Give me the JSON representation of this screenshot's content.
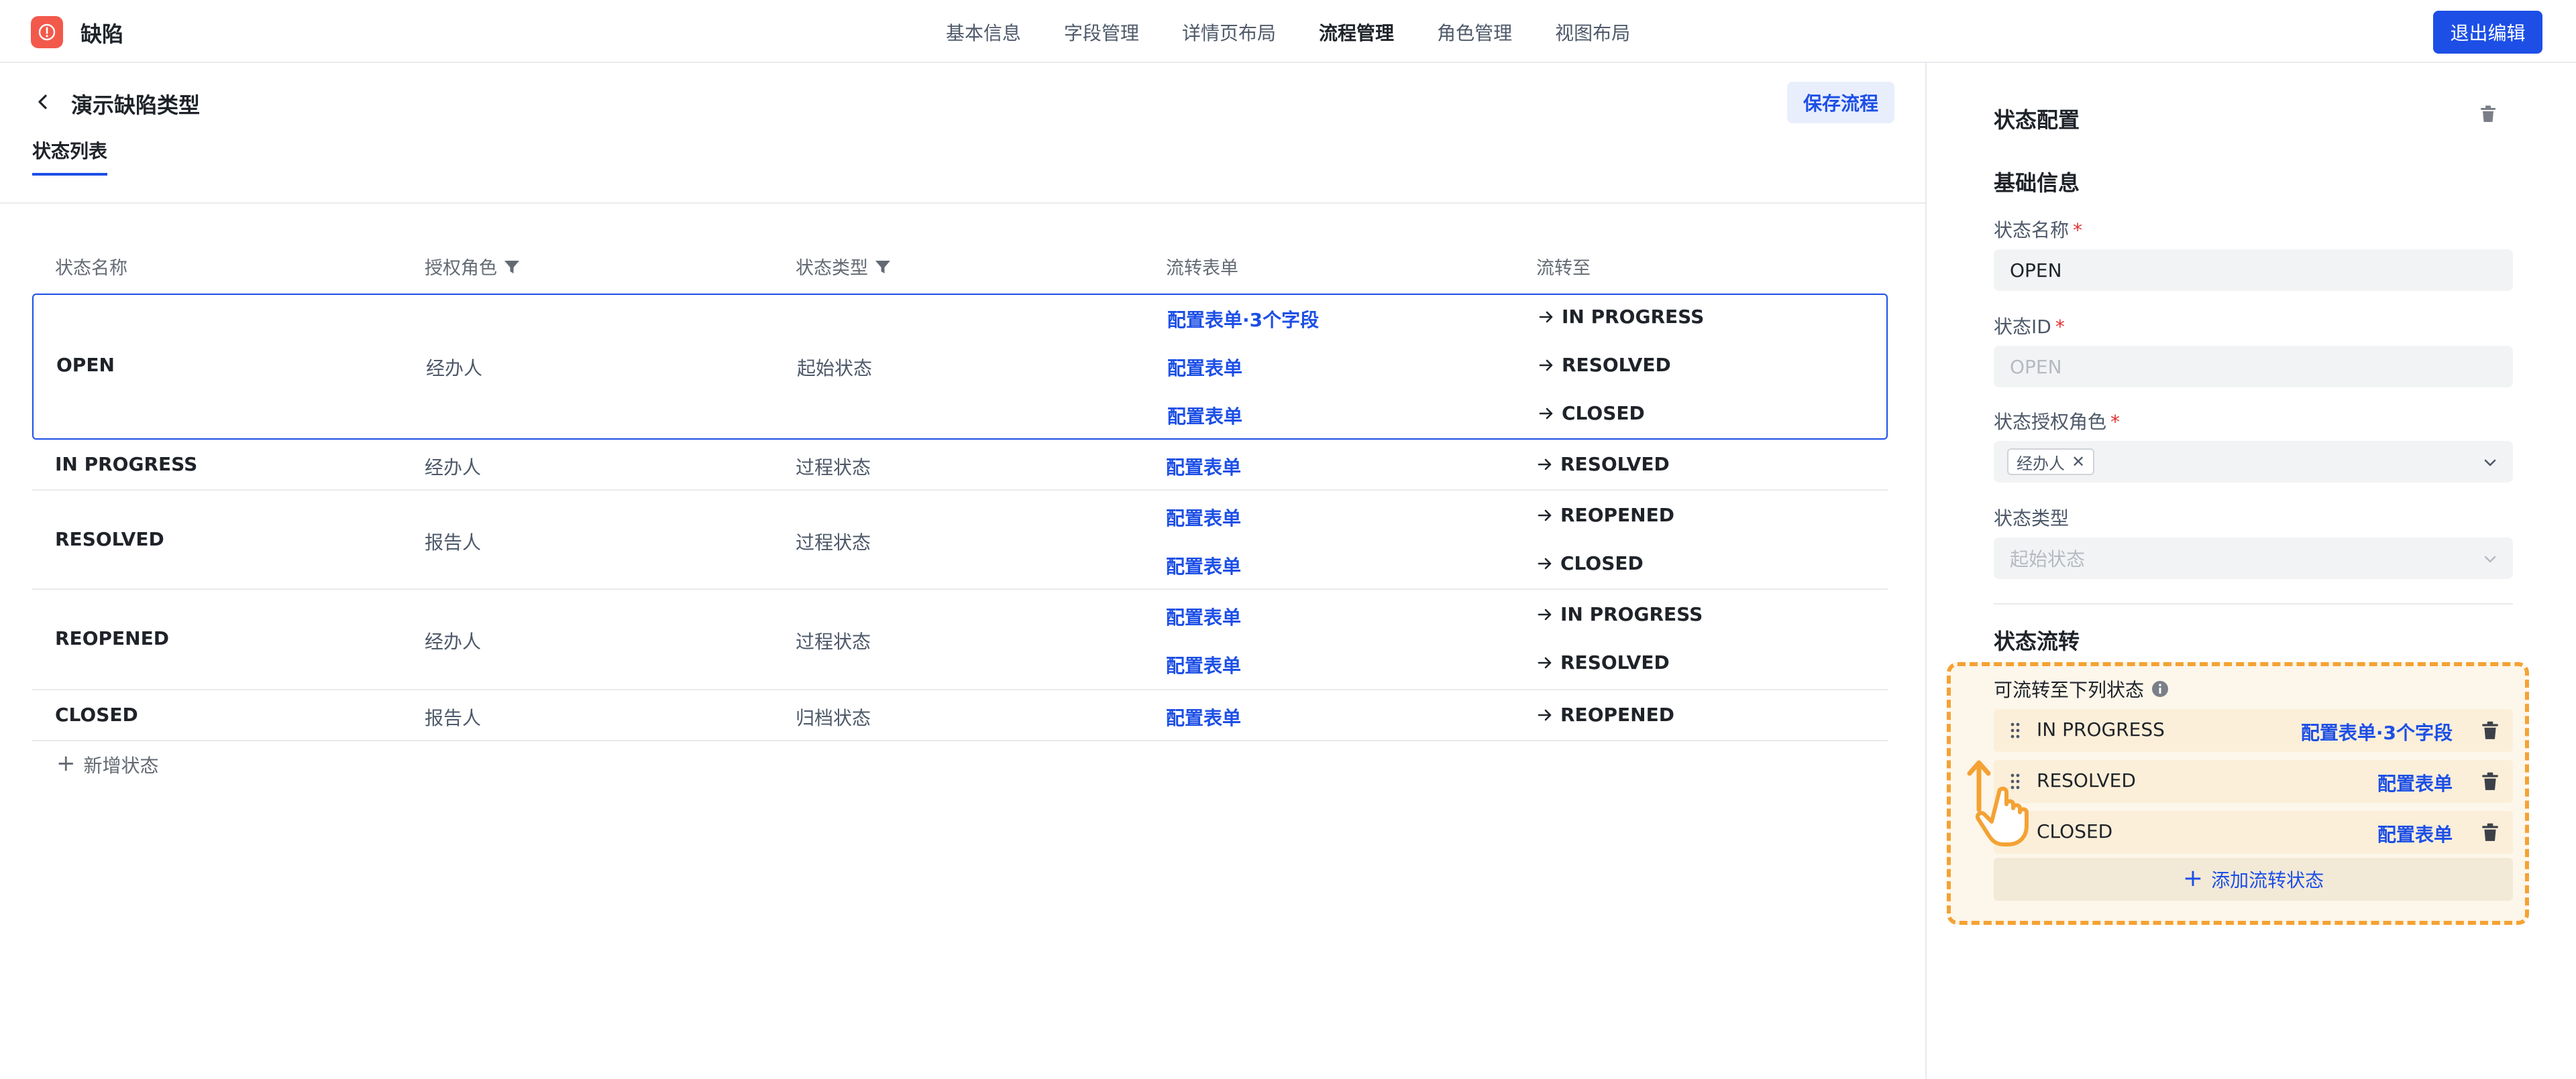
{
  "app": {
    "title": "缺陷"
  },
  "nav": {
    "items": [
      "基本信息",
      "字段管理",
      "详情页布局",
      "流程管理",
      "角色管理",
      "视图布局"
    ],
    "active_index": 3,
    "exit_label": "退出编辑"
  },
  "page": {
    "title": "演示缺陷类型",
    "save_label": "保存流程",
    "tab_label": "状态列表"
  },
  "table": {
    "headers": {
      "name": "状态名称",
      "role": "授权角色",
      "type": "状态类型",
      "form": "流转表单",
      "to": "流转至"
    },
    "rows": [
      {
        "name": "OPEN",
        "role": "经办人",
        "type": "起始状态",
        "selected": true,
        "transitions": [
          {
            "form": "配置表单·3个字段",
            "to": "IN PROGRESS"
          },
          {
            "form": "配置表单",
            "to": "RESOLVED"
          },
          {
            "form": "配置表单",
            "to": "CLOSED"
          }
        ]
      },
      {
        "name": "IN PROGRESS",
        "role": "经办人",
        "type": "过程状态",
        "transitions": [
          {
            "form": "配置表单",
            "to": "RESOLVED"
          }
        ]
      },
      {
        "name": "RESOLVED",
        "role": "报告人",
        "type": "过程状态",
        "transitions": [
          {
            "form": "配置表单",
            "to": "REOPENED"
          },
          {
            "form": "配置表单",
            "to": "CLOSED"
          }
        ]
      },
      {
        "name": "REOPENED",
        "role": "经办人",
        "type": "过程状态",
        "transitions": [
          {
            "form": "配置表单",
            "to": "IN PROGRESS"
          },
          {
            "form": "配置表单",
            "to": "RESOLVED"
          }
        ]
      },
      {
        "name": "CLOSED",
        "role": "报告人",
        "type": "归档状态",
        "transitions": [
          {
            "form": "配置表单",
            "to": "REOPENED"
          }
        ]
      }
    ],
    "add_label": "新增状态"
  },
  "config": {
    "title": "状态配置",
    "basic_title": "基础信息",
    "name_label": "状态名称",
    "name_value": "OPEN",
    "id_label": "状态ID",
    "id_placeholder": "OPEN",
    "role_label": "状态授权角色",
    "role_chip": "经办人",
    "type_label": "状态类型",
    "type_placeholder": "起始状态",
    "flow_title": "状态流转",
    "flow_subtitle": "可流转至下列状态",
    "transitions": [
      {
        "name": "IN PROGRESS",
        "link": "配置表单·3个字段"
      },
      {
        "name": "RESOLVED",
        "link": "配置表单"
      },
      {
        "name": "CLOSED",
        "link": "配置表单"
      }
    ],
    "add_transition_label": "添加流转状态"
  },
  "colors": {
    "accent": "#1d4fe6",
    "highlight_border": "#f4a234",
    "logo": "#f2594b",
    "required": "#e03131"
  }
}
